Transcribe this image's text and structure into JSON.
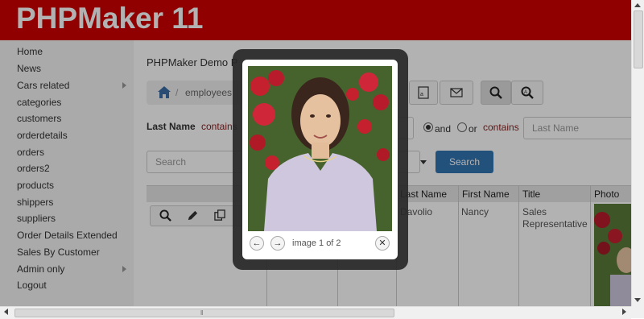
{
  "header": {
    "logo": "PHPMaker 11"
  },
  "sidebar": {
    "items": [
      {
        "label": "Home",
        "submenu": false
      },
      {
        "label": "News",
        "submenu": false
      },
      {
        "label": "Cars related",
        "submenu": true
      },
      {
        "label": "categories",
        "submenu": false
      },
      {
        "label": "customers",
        "submenu": false
      },
      {
        "label": "orderdetails",
        "submenu": false
      },
      {
        "label": "orders",
        "submenu": false
      },
      {
        "label": "orders2",
        "submenu": false
      },
      {
        "label": "products",
        "submenu": false
      },
      {
        "label": "shippers",
        "submenu": false
      },
      {
        "label": "suppliers",
        "submenu": false
      },
      {
        "label": "Order Details Extended",
        "submenu": false
      },
      {
        "label": "Sales By Customer",
        "submenu": false
      },
      {
        "label": "Admin only",
        "submenu": true
      },
      {
        "label": "Logout",
        "submenu": false
      }
    ]
  },
  "main": {
    "title": "PHPMaker Demo P",
    "breadcrumb": {
      "current": "employees"
    },
    "filter": {
      "field_label": "Last Name",
      "operator": "contains",
      "value_placeholder": "Last Name",
      "and_label": "and",
      "or_label": "or",
      "operator2": "contains"
    },
    "search": {
      "placeholder": "Search",
      "button": "Search"
    },
    "grid": {
      "columns": [
        "Last Name",
        "First Name",
        "Title",
        "Photo"
      ],
      "rows": [
        {
          "last_name": "Davolio",
          "first_name": "Nancy",
          "title": "Sales Representative"
        }
      ]
    }
  },
  "lightbox": {
    "caption": "image 1 of 2"
  },
  "colors": {
    "header": "#ce0000",
    "accent": "#3274b1"
  },
  "icons": [
    "home-icon",
    "search-icon",
    "zoom-icon",
    "pdf-icon",
    "email-icon",
    "view-icon",
    "edit-icon",
    "copy-icon",
    "prev-icon",
    "next-icon",
    "close-icon"
  ]
}
